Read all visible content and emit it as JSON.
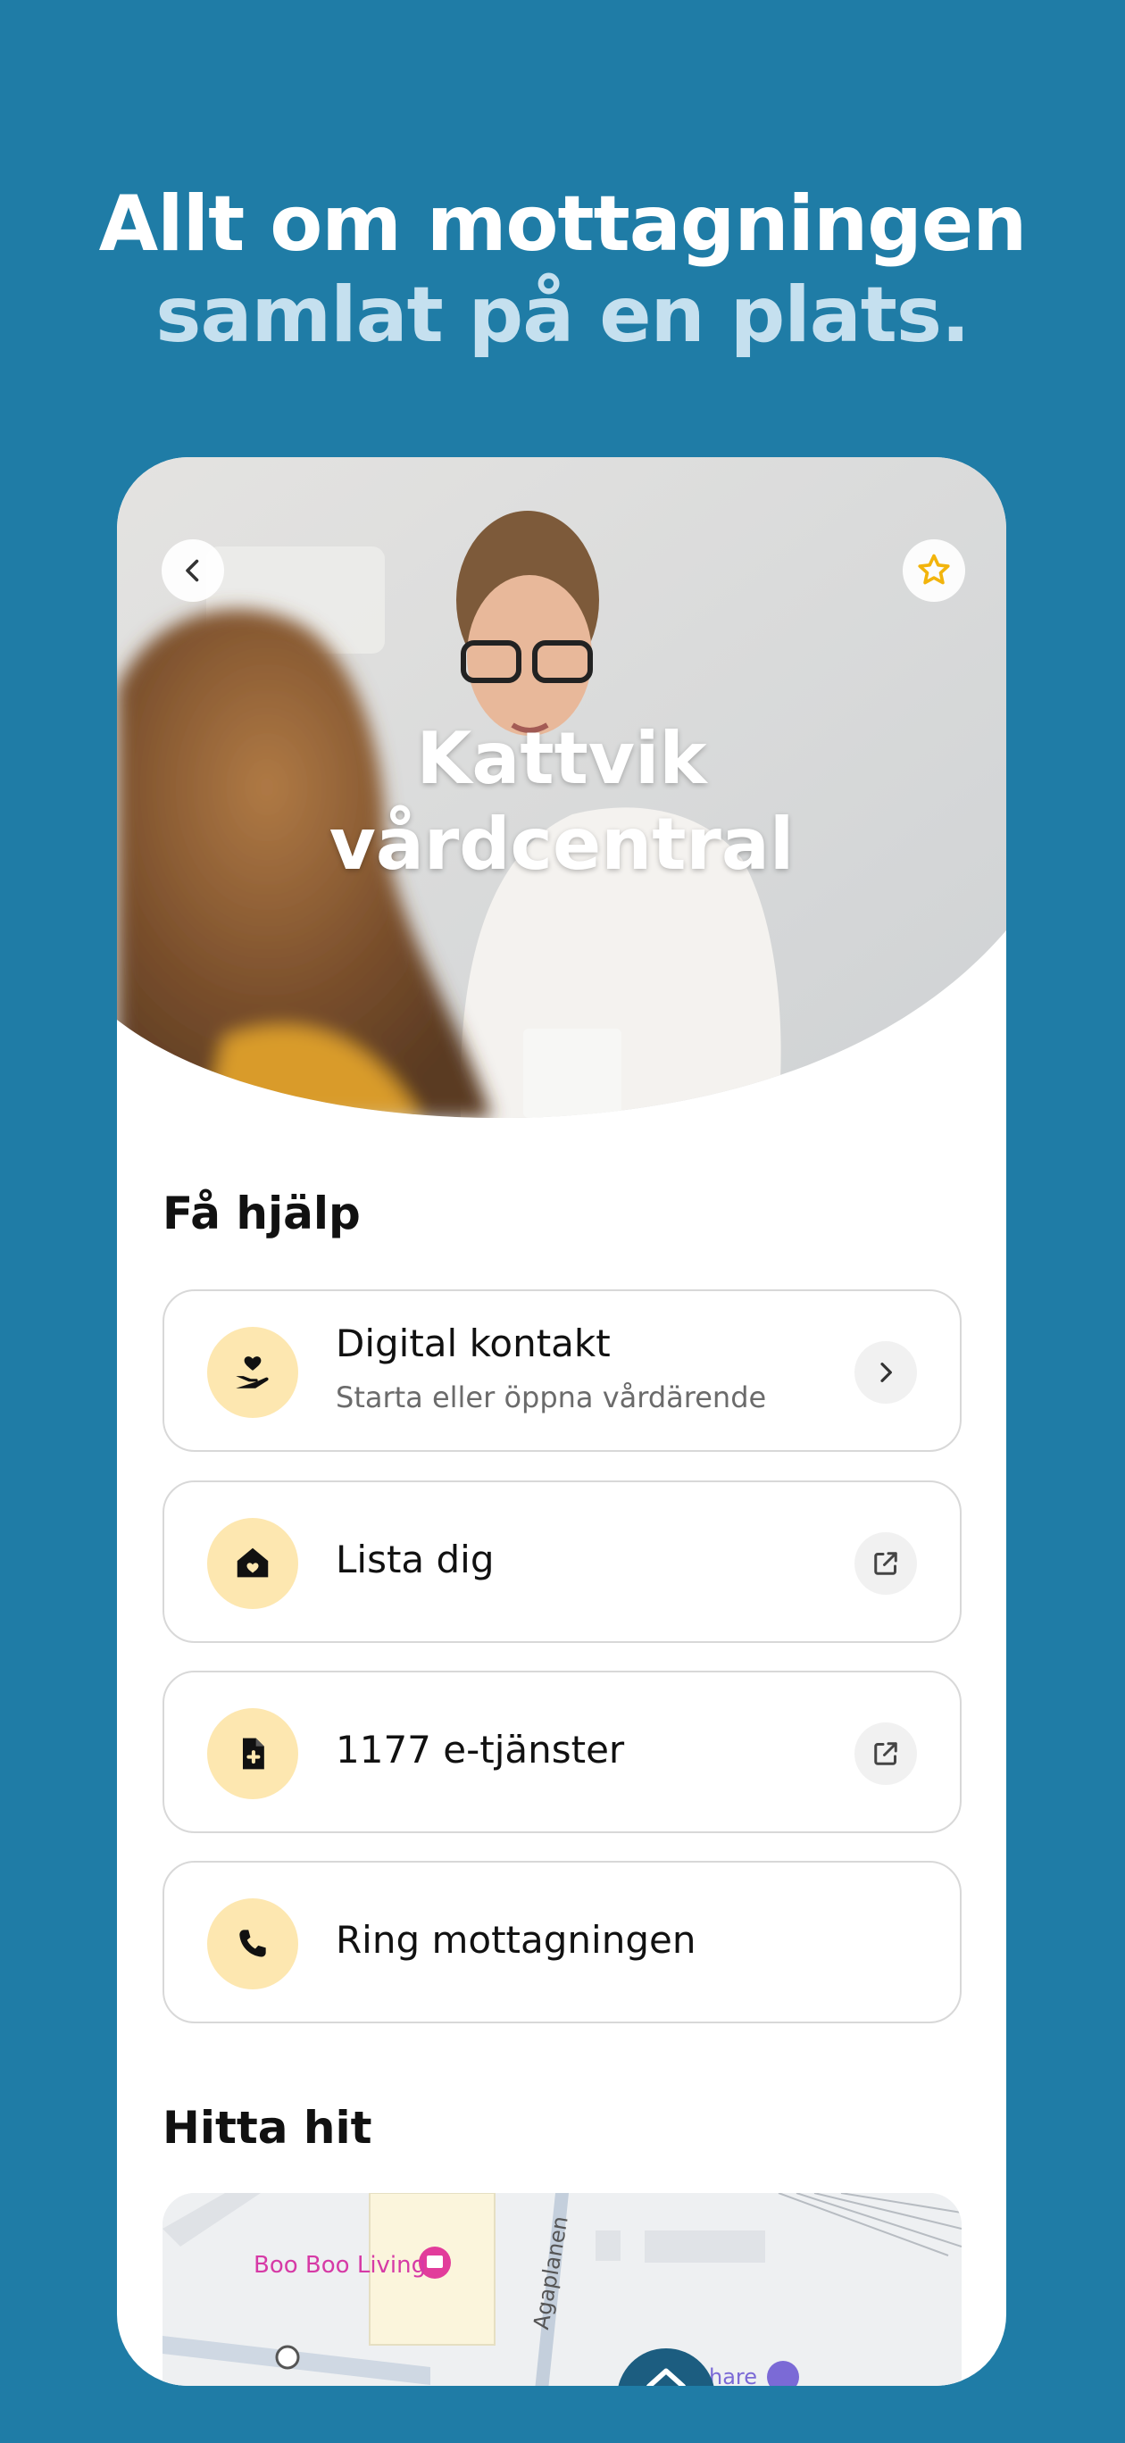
{
  "promo": {
    "line1": "Allt om mottagningen",
    "line2": "samlat på en plats."
  },
  "header": {
    "title_line1": "Kattvik",
    "title_line2": "vårdcentral",
    "back_icon": "chevron-left-icon",
    "favorite_icon": "star-icon"
  },
  "help": {
    "title": "Få hjälp",
    "items": [
      {
        "label": "Digital kontakt",
        "sublabel": "Starta eller öppna vårdärende",
        "icon": "heart-hand-icon",
        "trail": "chevron-right-icon"
      },
      {
        "label": "Lista dig",
        "icon": "home-heart-icon",
        "trail": "external-link-icon"
      },
      {
        "label": "1177 e-tjänster",
        "icon": "medical-document-icon",
        "trail": "external-link-icon"
      },
      {
        "label": "Ring mottagningen",
        "icon": "phone-icon"
      }
    ]
  },
  "directions": {
    "title": "Hitta hit",
    "map": {
      "poi": "Boo Boo Living",
      "street": "Agaplanen",
      "partial_label": "hare"
    }
  },
  "colors": {
    "background": "#1f7ca6",
    "icon_circle": "#fde7b0",
    "accent_star": "#f2b40c",
    "poi": "#d63aa6"
  }
}
